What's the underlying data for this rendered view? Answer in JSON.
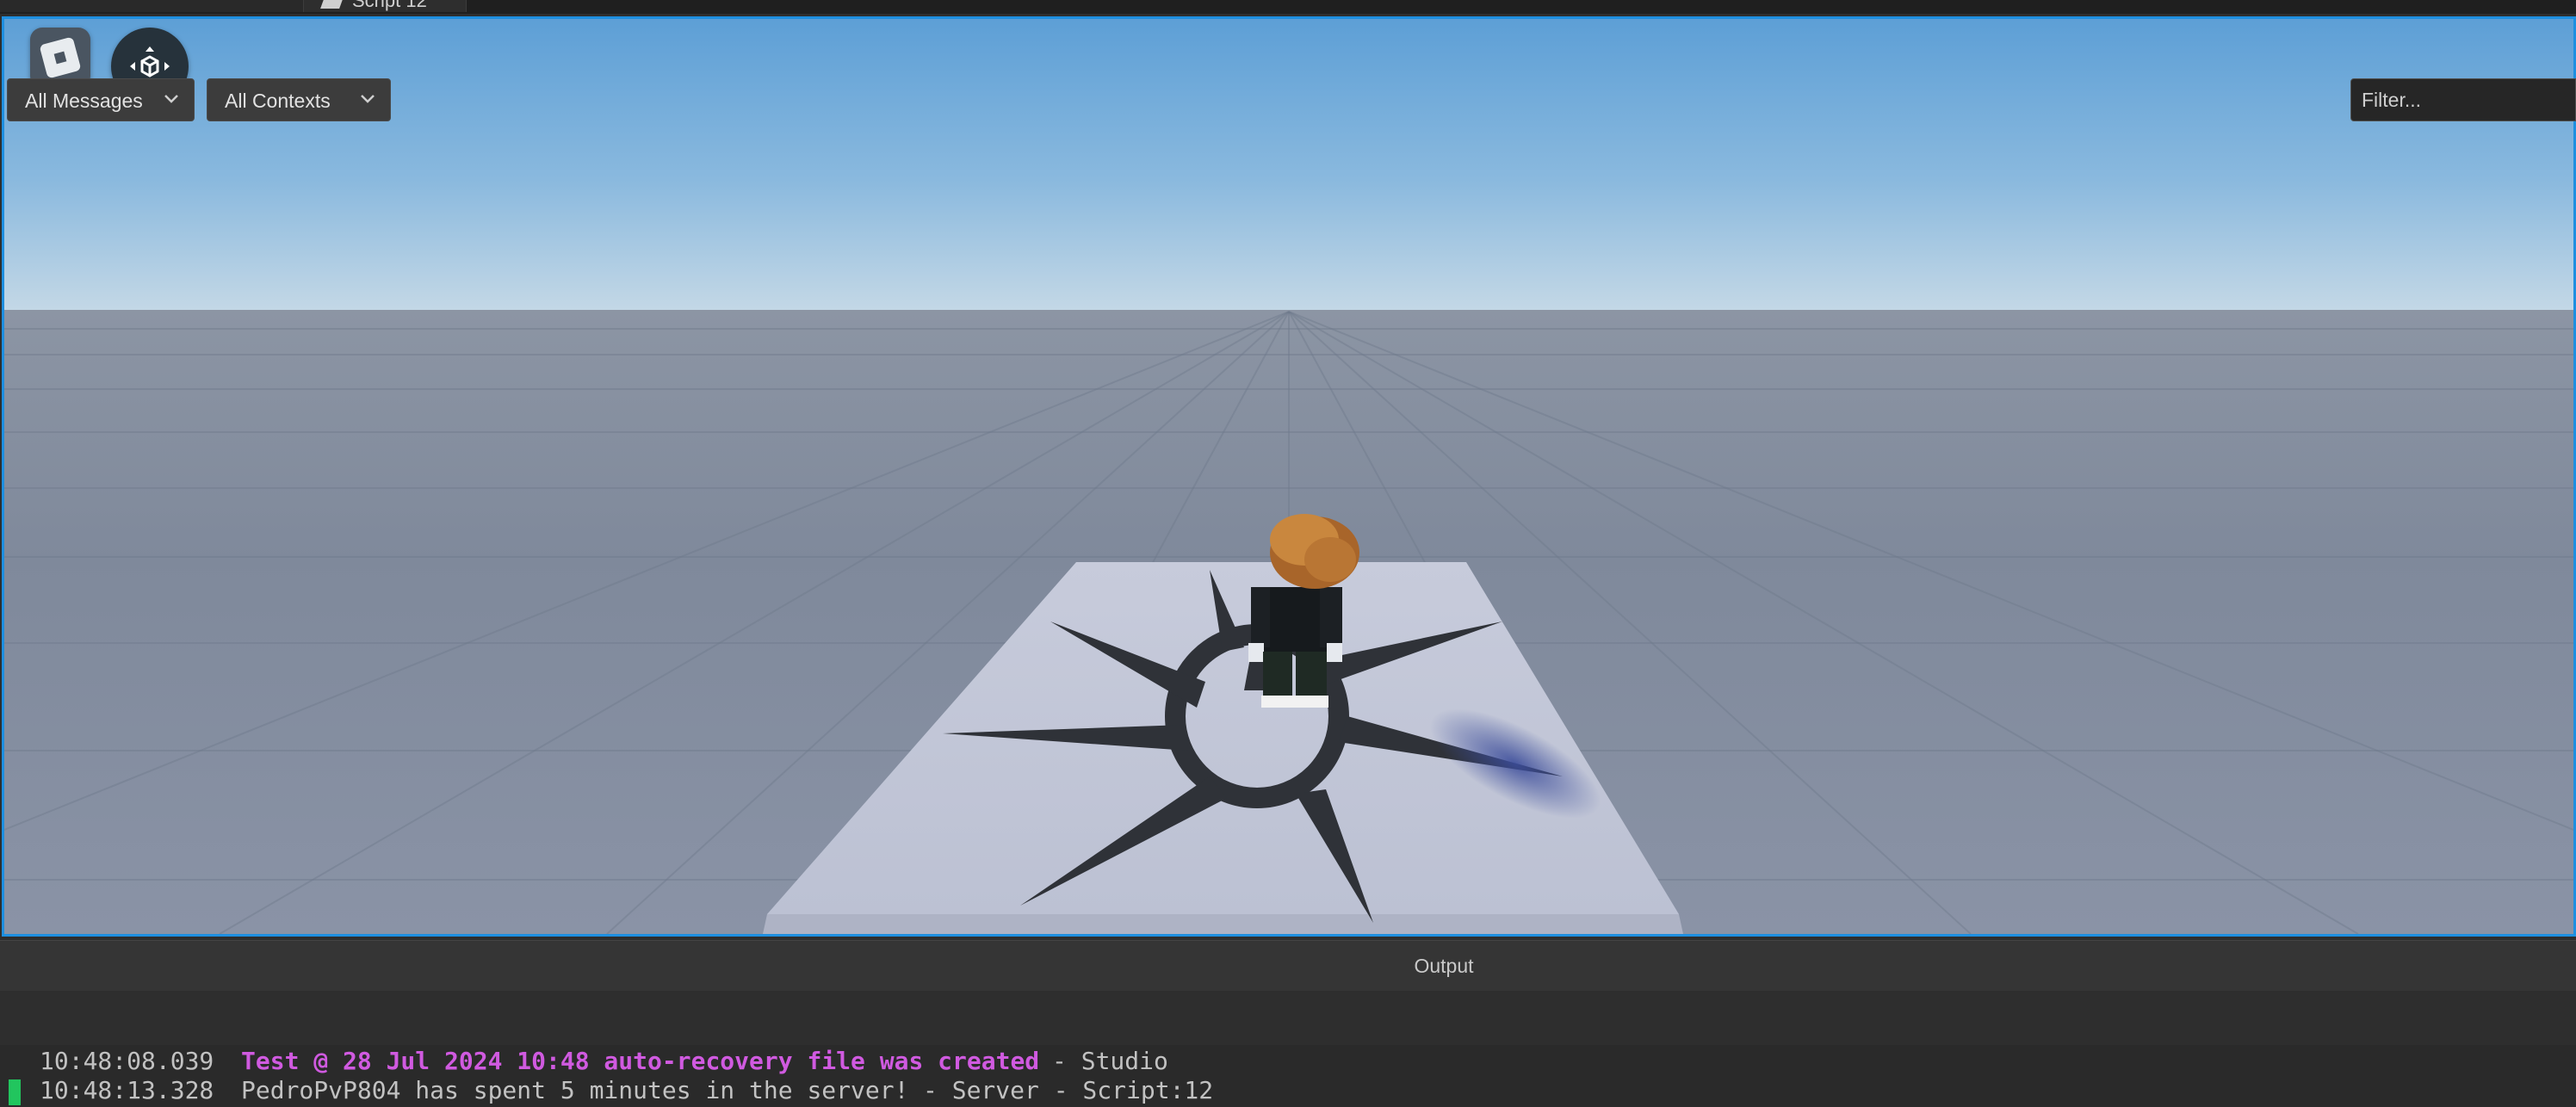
{
  "tabs": [
    {
      "label": "Script 12"
    }
  ],
  "viewport": {
    "roblox_button_icon": "roblox-logo-icon",
    "camera_button_icon": "camera-move-icon"
  },
  "output": {
    "title": "Output",
    "messages_dropdown": {
      "label": "All Messages"
    },
    "contexts_dropdown": {
      "label": "All Contexts"
    },
    "filter": {
      "placeholder": "Filter..."
    },
    "rows": [
      {
        "timestamp": "10:48:08.039",
        "message": "Test @ 28 Jul 2024 10:48 auto-recovery file was created",
        "source": "-  Studio"
      },
      {
        "timestamp": "10:48:13.328",
        "message": "PedroPvP804 has spent 5 minutes in the server!",
        "source": "-  Server - Script:12"
      }
    ]
  },
  "colors": {
    "viewport_border": "#1e8fe0",
    "highlight_message": "#d05ae0",
    "marker": "#22c55e"
  }
}
